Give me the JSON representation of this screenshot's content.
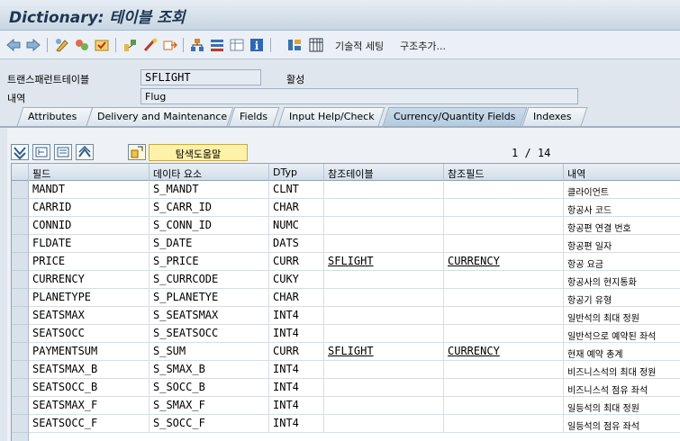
{
  "title": "Dictionary: 테이블 조회",
  "toolbar": {
    "icons": [
      "back-icon",
      "forward-icon",
      "display-change-icon",
      "other-object-icon",
      "check-icon",
      "activate-icon",
      "where-used-icon",
      "object-list-icon",
      "hierarchy-icon",
      "index-icon",
      "info-icon",
      "append-structure-icon",
      "contents-icon"
    ],
    "tech_settings": "기술적 세팅",
    "append": "구조추가..."
  },
  "header": {
    "table_label": "트랜스패런트테이블",
    "table_value": "SFLIGHT",
    "status": "활성",
    "desc_label": "내역",
    "desc_value": "Flug"
  },
  "tabs": [
    "Attributes",
    "Delivery and Maintenance",
    "Fields",
    "Input Help/Check",
    "Currency/Quantity Fields",
    "Indexes"
  ],
  "active_tab": "Currency/Quantity Fields",
  "grid_toolbar": {
    "help_button": "탐색도움말",
    "pager": "1 / 14"
  },
  "columns": [
    "필드",
    "데이타 요소",
    "DTyp",
    "참조테이블",
    "참조필드",
    "내역"
  ],
  "rows": [
    {
      "field": "MANDT",
      "element": "S_MANDT",
      "dtyp": "CLNT",
      "ref_table": "",
      "ref_field": "",
      "desc": "클라이언트"
    },
    {
      "field": "CARRID",
      "element": "S_CARR_ID",
      "dtyp": "CHAR",
      "ref_table": "",
      "ref_field": "",
      "desc": "항공사 코드"
    },
    {
      "field": "CONNID",
      "element": "S_CONN_ID",
      "dtyp": "NUMC",
      "ref_table": "",
      "ref_field": "",
      "desc": "항공편 연결 번호"
    },
    {
      "field": "FLDATE",
      "element": "S_DATE",
      "dtyp": "DATS",
      "ref_table": "",
      "ref_field": "",
      "desc": "항공편 일자"
    },
    {
      "field": "PRICE",
      "element": "S_PRICE",
      "dtyp": "CURR",
      "ref_table": "SFLIGHT",
      "ref_field": "CURRENCY",
      "desc": "항공 요금"
    },
    {
      "field": "CURRENCY",
      "element": "S_CURRCODE",
      "dtyp": "CUKY",
      "ref_table": "",
      "ref_field": "",
      "desc": "항공사의 현지통화"
    },
    {
      "field": "PLANETYPE",
      "element": "S_PLANETYE",
      "dtyp": "CHAR",
      "ref_table": "",
      "ref_field": "",
      "desc": "항공기 유형"
    },
    {
      "field": "SEATSMAX",
      "element": "S_SEATSMAX",
      "dtyp": "INT4",
      "ref_table": "",
      "ref_field": "",
      "desc": "일반석의 최대 정원"
    },
    {
      "field": "SEATSOCC",
      "element": "S_SEATSOCC",
      "dtyp": "INT4",
      "ref_table": "",
      "ref_field": "",
      "desc": "일반석으로 예약된 좌석"
    },
    {
      "field": "PAYMENTSUM",
      "element": "S_SUM",
      "dtyp": "CURR",
      "ref_table": "SFLIGHT",
      "ref_field": "CURRENCY",
      "desc": "현재 예약 총계"
    },
    {
      "field": "SEATSMAX_B",
      "element": "S_SMAX_B",
      "dtyp": "INT4",
      "ref_table": "",
      "ref_field": "",
      "desc": "비즈니스석의 최대 정원"
    },
    {
      "field": "SEATSOCC_B",
      "element": "S_SOCC_B",
      "dtyp": "INT4",
      "ref_table": "",
      "ref_field": "",
      "desc": "비즈니스석 점유 좌석"
    },
    {
      "field": "SEATSMAX_F",
      "element": "S_SMAX_F",
      "dtyp": "INT4",
      "ref_table": "",
      "ref_field": "",
      "desc": "일등석의 최대 정원"
    },
    {
      "field": "SEATSOCC_F",
      "element": "S_SOCC_F",
      "dtyp": "INT4",
      "ref_table": "",
      "ref_field": "",
      "desc": "일등석의 점유 좌석"
    }
  ]
}
